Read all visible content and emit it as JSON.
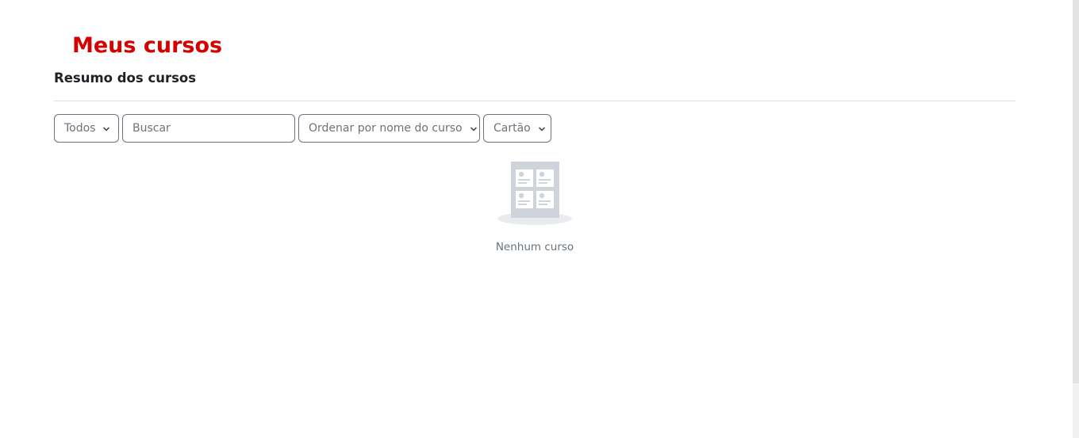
{
  "page": {
    "title": "Meus cursos",
    "title_color": "#d50000"
  },
  "course_overview": {
    "heading": "Resumo dos cursos",
    "filter": {
      "selected": "Todos",
      "icon": "chevron-down-icon"
    },
    "search": {
      "placeholder": "Buscar",
      "value": ""
    },
    "sort": {
      "selected": "Ordenar por nome do curso",
      "icon": "chevron-down-icon"
    },
    "view": {
      "selected": "Cartão",
      "icon": "chevron-down-icon"
    },
    "empty_state": {
      "icon": "empty-courses-icon",
      "message": "Nenhum curso"
    }
  }
}
